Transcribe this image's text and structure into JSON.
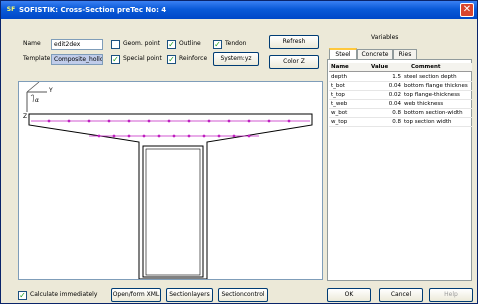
{
  "window": {
    "title": "SOFISTIK: Cross-Section preTec No:  4",
    "icon_text": "SF"
  },
  "form": {
    "name_label": "Name",
    "name_value": "edit2dex",
    "template_label": "Template",
    "template_value": "Composite_hollow",
    "checkboxes": [
      {
        "label": "Geom. point",
        "checked": false
      },
      {
        "label": "Outline",
        "checked": true
      },
      {
        "label": "Tendon",
        "checked": true
      },
      {
        "label": "Special point",
        "checked": true
      },
      {
        "label": "Reinforce",
        "checked": true
      }
    ],
    "systemyz_label": "System:yz",
    "refresh_label": "Refresh",
    "color_label": "Color Z"
  },
  "canvas": {
    "axis_y": "Y",
    "axis_z": "Z",
    "alpha_label": "α"
  },
  "variables": {
    "title": "Variables",
    "tabs": [
      "Steel",
      "Concrete",
      "Ries"
    ],
    "columns": [
      "Name",
      "Value",
      "Comment"
    ],
    "rows": [
      {
        "name": "depth",
        "value": "1.5",
        "comment": "steel section depth"
      },
      {
        "name": "t_bot",
        "value": "0.04",
        "comment": "bottom flange thicknes"
      },
      {
        "name": "t_top",
        "value": "0.02",
        "comment": "top flange-thickness"
      },
      {
        "name": "t_web",
        "value": "0.04",
        "comment": "web thickness"
      },
      {
        "name": "w_bot",
        "value": "0.8",
        "comment": "bottom section-width"
      },
      {
        "name": "w_top",
        "value": "0.8",
        "comment": "top section width"
      }
    ]
  },
  "bottom": {
    "calculate_label": "Calculate immediately",
    "calculate_checked": true,
    "open_xml": "Open/form XML",
    "section_layers": "Sectionlayers",
    "section_control": "Sectioncontrol",
    "ok": "OK",
    "cancel": "Cancel",
    "help": "Help"
  }
}
